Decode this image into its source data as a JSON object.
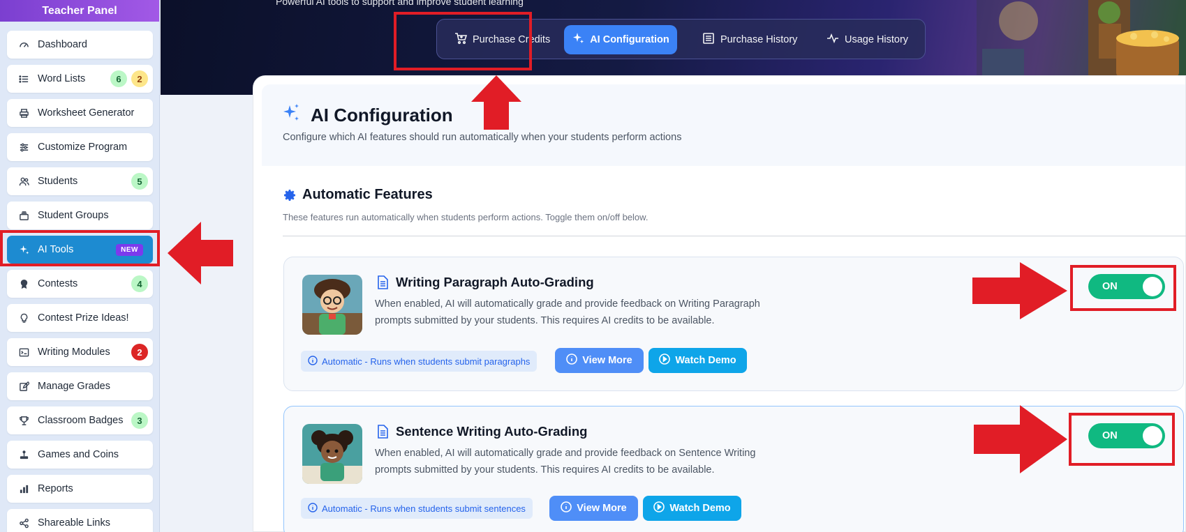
{
  "sidebar": {
    "title": "Teacher Panel",
    "items": [
      {
        "label": "Dashboard",
        "icon": "dashboard-icon"
      },
      {
        "label": "Word Lists",
        "icon": "list-icon",
        "badges": [
          "6",
          "2"
        ]
      },
      {
        "label": "Worksheet Generator",
        "icon": "printer-icon"
      },
      {
        "label": "Customize Program",
        "icon": "sliders-icon"
      },
      {
        "label": "Students",
        "icon": "users-icon",
        "badges": [
          "5"
        ]
      },
      {
        "label": "Student Groups",
        "icon": "groups-icon"
      },
      {
        "label": "AI Tools",
        "icon": "sparkle-icon",
        "tag": "NEW"
      },
      {
        "label": "Contests",
        "icon": "medal-icon",
        "badges": [
          "4"
        ]
      },
      {
        "label": "Contest Prize Ideas!",
        "icon": "lightbulb-icon"
      },
      {
        "label": "Writing Modules",
        "icon": "terminal-icon",
        "badges": [
          "2"
        ]
      },
      {
        "label": "Manage Grades",
        "icon": "edit-icon"
      },
      {
        "label": "Classroom Badges",
        "icon": "trophy-icon",
        "badges": [
          "3"
        ]
      },
      {
        "label": "Games and Coins",
        "icon": "joystick-icon"
      },
      {
        "label": "Reports",
        "icon": "bar-chart-icon"
      },
      {
        "label": "Shareable Links",
        "icon": "share-icon"
      }
    ]
  },
  "header": {
    "subtitle": "Powerful AI tools to support and improve student learning",
    "tabs": [
      {
        "label": "Purchase Credits",
        "icon": "cart-icon"
      },
      {
        "label": "AI Configuration",
        "icon": "sparkle-icon"
      },
      {
        "label": "Purchase History",
        "icon": "receipt-icon"
      },
      {
        "label": "Usage History",
        "icon": "activity-icon"
      }
    ]
  },
  "main": {
    "title": "AI Configuration",
    "description": "Configure which AI features should run automatically when your students perform actions",
    "section_title": "Automatic Features",
    "section_description": "These features run automatically when students perform actions. Toggle them on/off below.",
    "features": [
      {
        "title": "Writing Paragraph Auto-Grading",
        "description": "When enabled, AI will automatically grade and provide feedback on Writing Paragraph prompts submitted by your students. This requires AI credits to be available.",
        "info": "Automatic - Runs when students submit paragraphs",
        "view_more": "View More",
        "watch_demo": "Watch Demo",
        "toggle_label": "ON"
      },
      {
        "title": "Sentence Writing Auto-Grading",
        "description": "When enabled, AI will automatically grade and provide feedback on Sentence Writing prompts submitted by your students. This requires AI credits to be available.",
        "info": "Automatic - Runs when students submit sentences",
        "view_more": "View More",
        "watch_demo": "Watch Demo",
        "toggle_label": "ON"
      }
    ]
  },
  "colors": {
    "accent": "#3b82f6",
    "active_nav": "#1d8bd1",
    "toggle_on": "#10b981",
    "annotation_red": "#e11d26"
  }
}
